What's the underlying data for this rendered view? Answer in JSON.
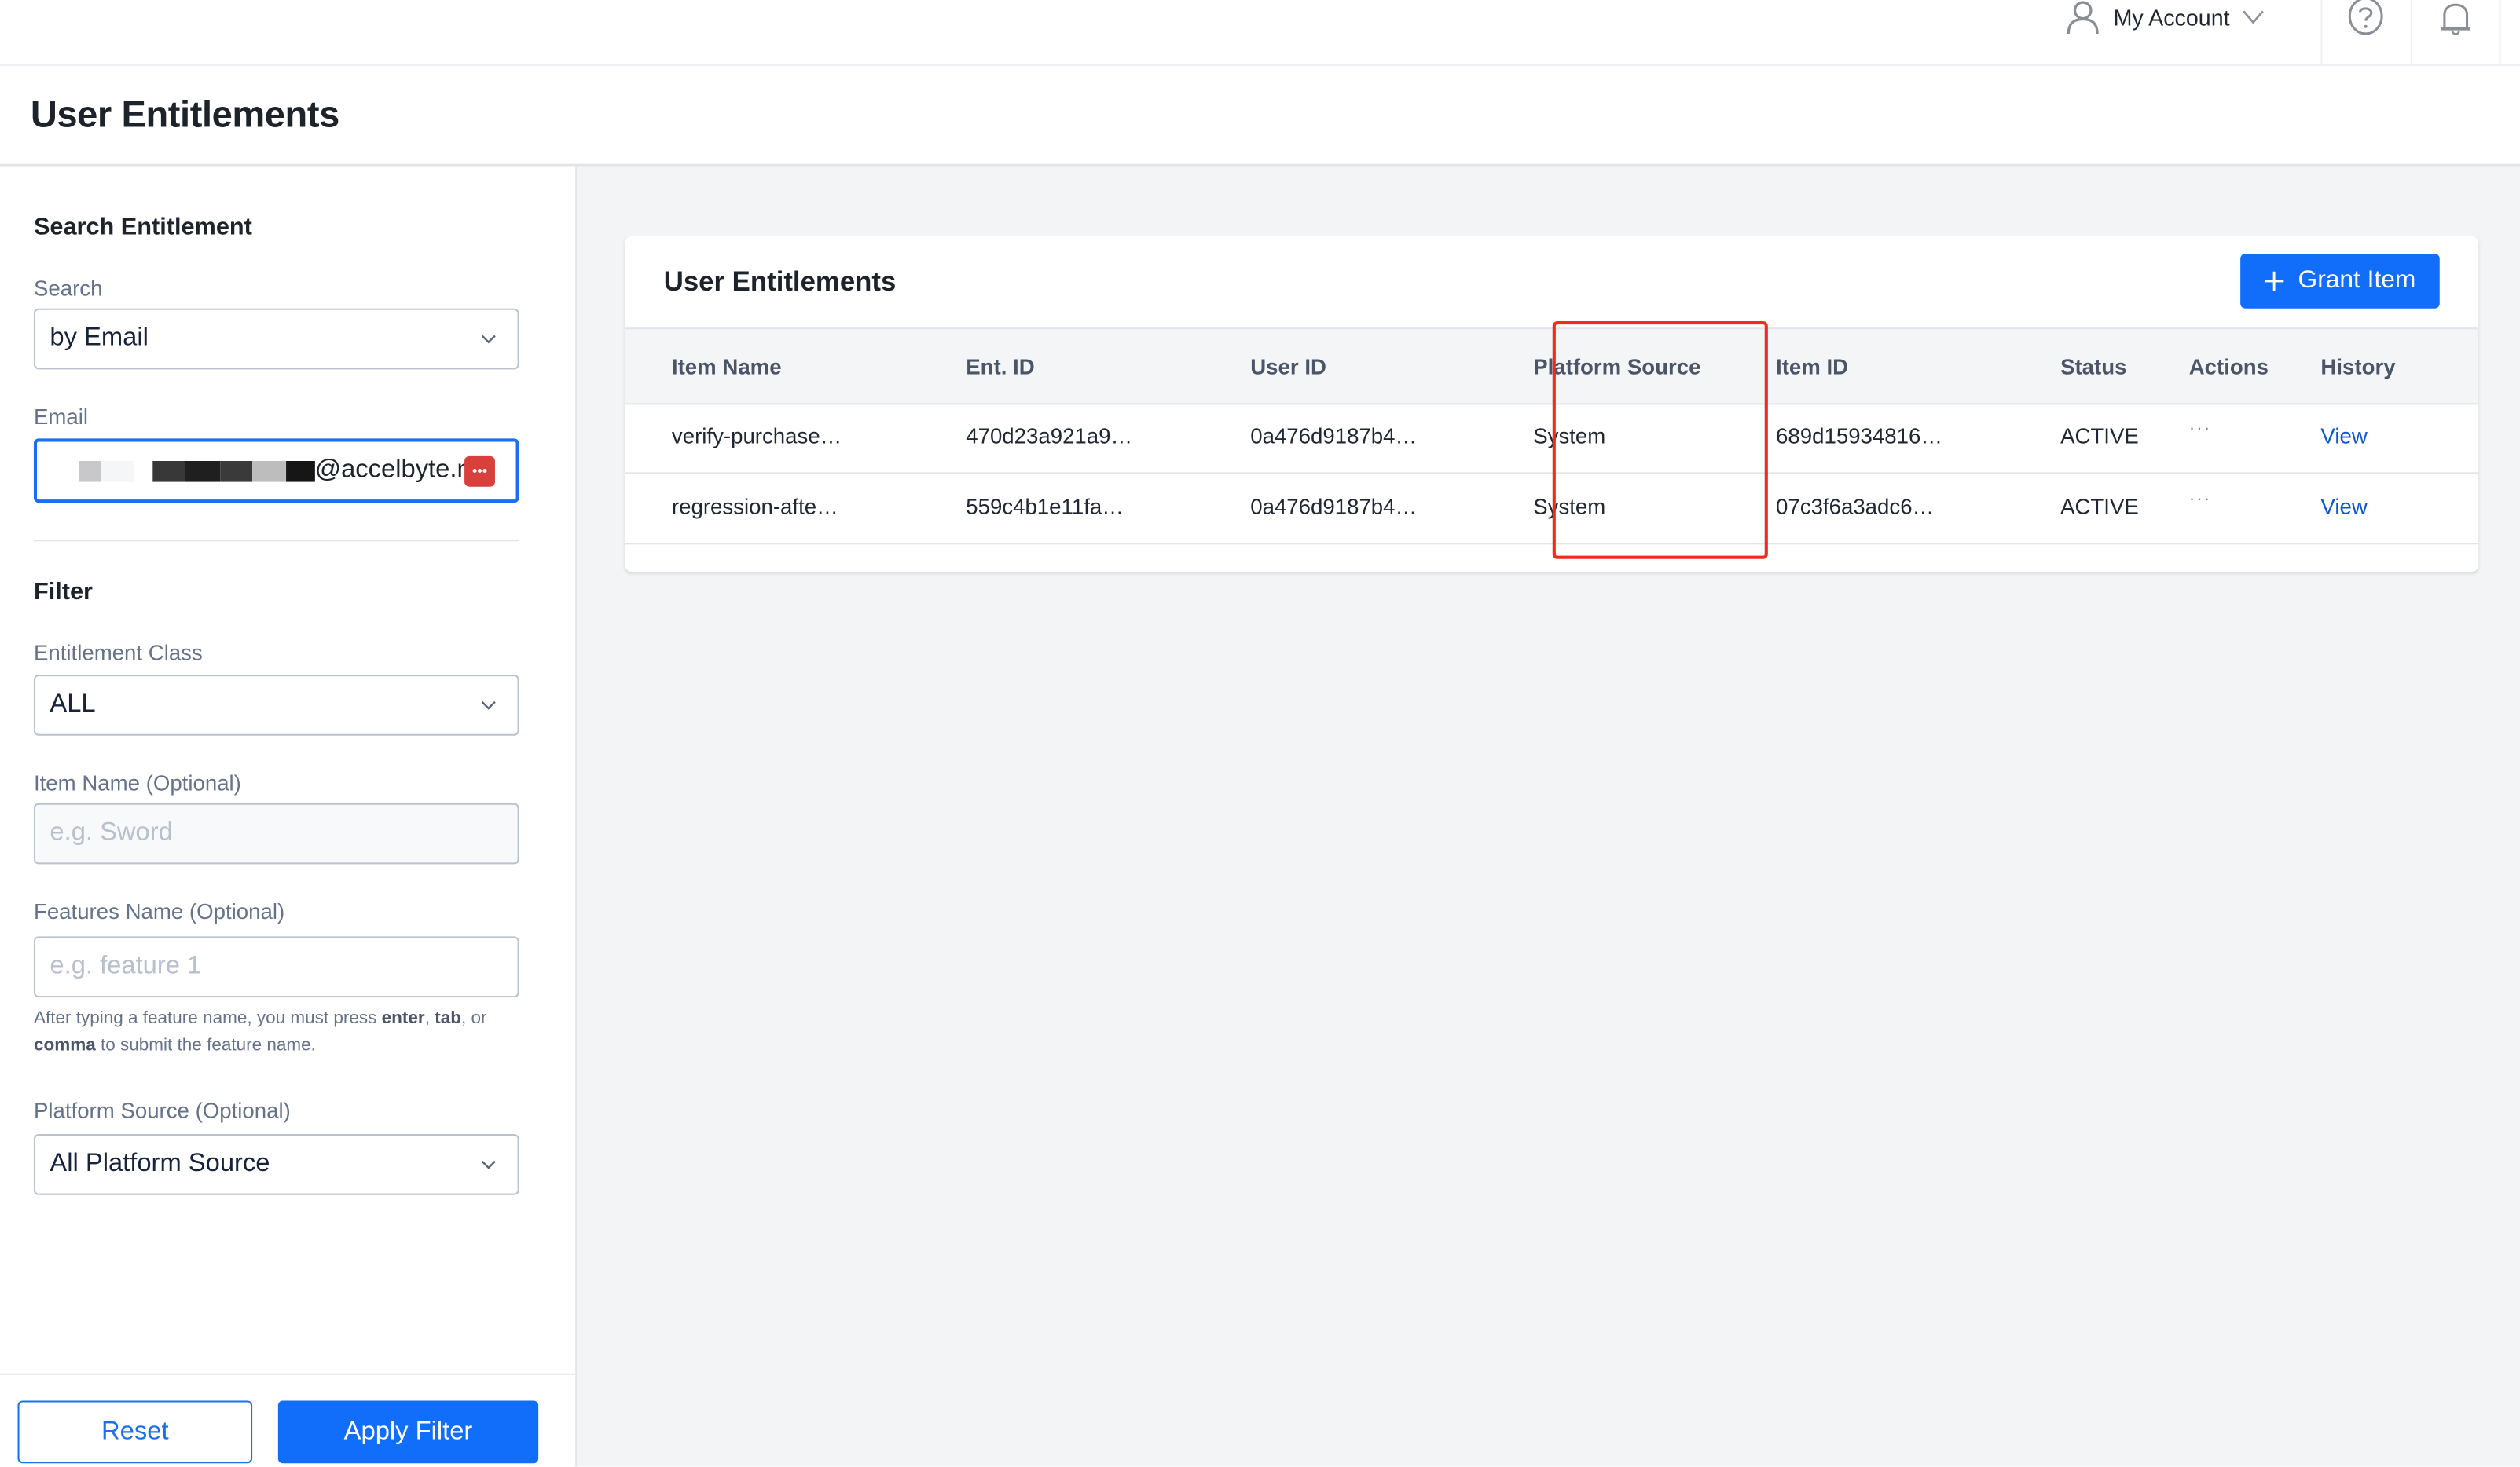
{
  "topbar": {
    "account_label": "My Account",
    "icons": [
      "user-icon",
      "chevron-down-icon",
      "help-icon",
      "bell-icon"
    ]
  },
  "page": {
    "title": "User Entitlements"
  },
  "search": {
    "section_title": "Search Entitlement",
    "search_label": "Search",
    "search_by_value": "by Email",
    "email_label": "Email",
    "email_value_visible": "@accelbyte.net",
    "email_prefix_redacted": true
  },
  "filter": {
    "section_title": "Filter",
    "entitlement_class_label": "Entitlement Class",
    "entitlement_class_value": "ALL",
    "item_name_label": "Item Name (Optional)",
    "item_name_placeholder": "e.g. Sword",
    "features_label": "Features Name (Optional)",
    "features_placeholder": "e.g. feature 1",
    "hint": {
      "part1": "After typing a feature name, you must press ",
      "enter": "enter",
      "sep1": ", ",
      "tab": "tab",
      "sep2": ", or ",
      "comma": "comma",
      "part2": " to submit the feature name."
    },
    "platform_source_label": "Platform Source (Optional)",
    "platform_source_value": "All Platform Source",
    "reset_label": "Reset",
    "apply_label": "Apply Filter"
  },
  "entitlements": {
    "title": "User Entitlements",
    "grant_label": "Grant Item",
    "columns": [
      "Item Name",
      "Ent. ID",
      "User ID",
      "Platform Source",
      "Item ID",
      "Status",
      "Actions",
      "History"
    ],
    "rows": [
      {
        "item_name": "verify-purchase…",
        "ent_id": "470d23a921a9…",
        "user_id": "0a476d9187b4…",
        "platform_source": "System",
        "item_id": "689d15934816…",
        "status": "ACTIVE",
        "actions": "···",
        "history": "View"
      },
      {
        "item_name": "regression-afte…",
        "ent_id": "559c4b1e11fa…",
        "user_id": "0a476d9187b4…",
        "platform_source": "System",
        "item_id": "07c3f6a3adc6…",
        "status": "ACTIVE",
        "actions": "···",
        "history": "View"
      }
    ],
    "highlighted_column": "Platform Source"
  },
  "colors": {
    "primary": "#106efb",
    "link": "#0b57d0",
    "highlight_box": "#f02a1c",
    "password_manager_icon": "#d9403b"
  }
}
